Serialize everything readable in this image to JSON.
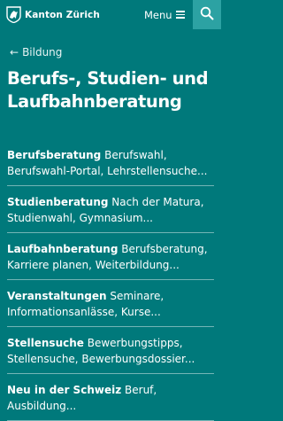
{
  "header": {
    "logo_text": "Kanton Zürich",
    "menu_label": "Menu"
  },
  "nav": {
    "back_label": "Bildung"
  },
  "page": {
    "title": "Berufs-, Studien- und Laufbahnberatung"
  },
  "items": [
    {
      "title": "Berufsberatung",
      "desc": "Berufswahl, Berufswahl-Portal, Lehrstellensuche..."
    },
    {
      "title": "Studienberatung",
      "desc": "Nach der Matura, Studienwahl, Gymnasium..."
    },
    {
      "title": "Laufbahnberatung",
      "desc": "Berufsberatung, Karriere planen, Weiterbildung..."
    },
    {
      "title": "Veranstaltungen",
      "desc": "Seminare, Informationsanlässe, Kurse..."
    },
    {
      "title": "Stellensuche",
      "desc": "Bewerbungstipps, Stellensuche, Bewerbungsdossier..."
    },
    {
      "title": "Neu in der Schweiz",
      "desc": "Beruf, Ausbildung..."
    }
  ],
  "colors": {
    "background": "#00797b",
    "search_bg": "#2ca2a3",
    "text": "#ffffff"
  }
}
